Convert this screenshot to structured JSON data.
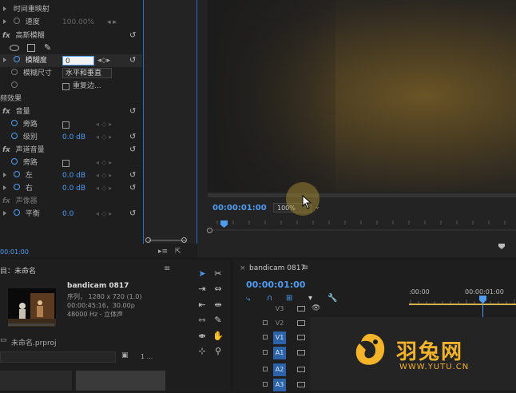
{
  "effect_controls": {
    "time_remap_label": "时间重映射",
    "speed_label": "速度",
    "speed_value": "100.00%",
    "gaussian_blur_label": "高斯模糊",
    "blurriness_label": "模糊度",
    "blurriness_value": "0",
    "blur_dimensions_label": "模糊尺寸",
    "blur_dimensions_value": "水平和垂直",
    "repeat_edge_label": "重复边...",
    "audio_effects_label": "频效果",
    "volume_label": "音量",
    "bypass_label": "旁路",
    "level_label": "级别",
    "level_value": "0.0 dB",
    "channel_volume_label": "声道音量",
    "bypass2_label": "旁路",
    "left_label": "左",
    "left_value": "0.0 dB",
    "right_label": "右",
    "right_value": "0.0 dB",
    "panner_label": "声像器",
    "balance_label": "平衡",
    "balance_value": "0.0",
    "bottom_timecode": "00:01:00"
  },
  "program_monitor": {
    "timecode": "00:00:01:00",
    "zoom": "100%"
  },
  "project": {
    "title": "目：未命名",
    "clip_name": "bandicam 0817",
    "clip_type": "序列，  1280 x 720 (1.0)",
    "clip_duration": "00:00:45:16，30.00p",
    "clip_audio": "48000 Hz - 立体声",
    "project_file": "未命名.prproj",
    "items_count": "1 ..."
  },
  "timeline": {
    "tab_label": "bandicam 0817",
    "timecode": "00:00:01:00",
    "ruler_start": ":00:00",
    "ruler_mark": "00:00:01:00",
    "tracks": [
      "V3",
      "V2",
      "V1",
      "A1",
      "A2",
      "A3"
    ]
  },
  "watermark": {
    "brand": "羽兔网",
    "url": "WWW.YUTU.CN"
  },
  "colors": {
    "accent": "#4f9cf2",
    "track_selected": "#2c63a8",
    "watermark": "#f5b32a"
  }
}
